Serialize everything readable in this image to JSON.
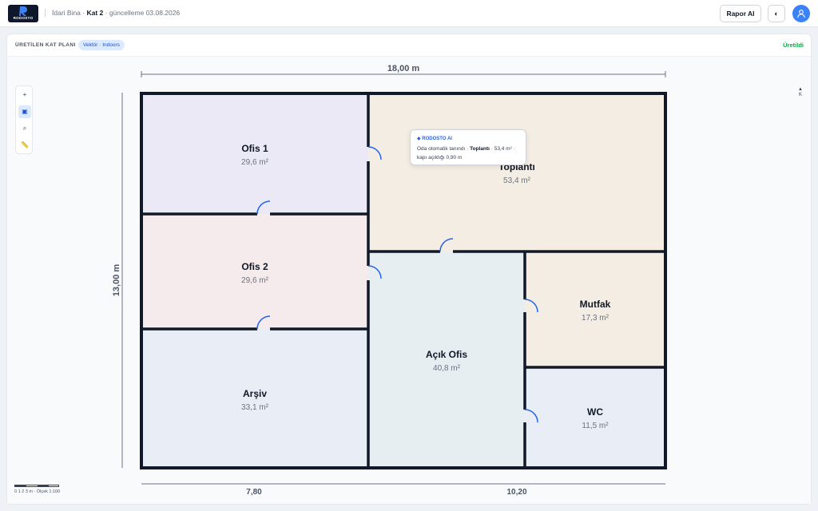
{
  "app": {
    "brand": "RODOSTO",
    "breadcrumb": {
      "building": "İdari Bina",
      "sep1": " · ",
      "floor": "Kat 2",
      "updated": " · güncelleme 03.08.2026"
    },
    "report_button": "Rapor AI",
    "theme_icon": "◐"
  },
  "panel": {
    "title": "ÜRETİLEN KAT PLANI",
    "badge": "Vektör · Indoors",
    "status": "Üretildi"
  },
  "toolbar": {
    "icons": [
      "plus-icon",
      "select-icon",
      "zoom-icon",
      "ruler-icon"
    ],
    "glyphs": [
      "+",
      "▣",
      "⌕",
      "📏"
    ]
  },
  "compass": {
    "arrow": "▲",
    "label": "K"
  },
  "plan": {
    "width_label": "18,00 m",
    "height_label": "13,00 m",
    "bottom_left_label": "7,80",
    "bottom_right_label": "10,20",
    "rooms": [
      {
        "name": "Ofis 1",
        "area": "29,6 m²",
        "color": "#ebe9f5"
      },
      {
        "name": "Ofis 2",
        "area": "29,6 m²",
        "color": "#f5eaec"
      },
      {
        "name": "Arşiv",
        "area": "33,1 m²",
        "color": "#e9edf5"
      },
      {
        "name": "Toplantı",
        "area": "53,4 m²",
        "color": "#f3ede3"
      },
      {
        "name": "Açık Ofis",
        "area": "40,8 m²",
        "color": "#e7eef2"
      },
      {
        "name": "Mutfak",
        "area": "17,3 m²",
        "color": "#f3ede3"
      },
      {
        "name": "WC",
        "area": "11,5 m²",
        "color": "#e9edf5"
      }
    ]
  },
  "tooltip": {
    "title": "◆ RODOSTO AI",
    "line1": "Oda otomatik tanındı · ",
    "room": "Toplantı",
    "line2": " · 53,4 m² · kapı açıklığı 0,90 m"
  },
  "scale": {
    "text": "0 1 2 3 m · Ölçek 1:100"
  },
  "colors": {
    "accent": "#2563eb",
    "wall": "#111827",
    "door": "#2563eb",
    "status": "#16a34a"
  }
}
